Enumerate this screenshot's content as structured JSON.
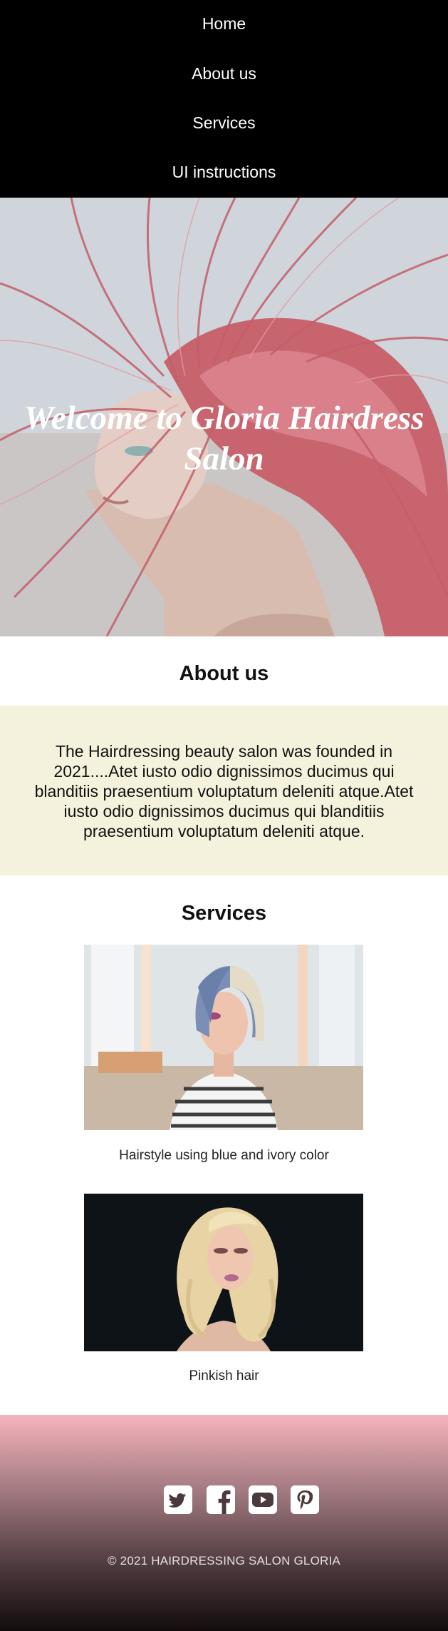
{
  "nav": {
    "items": [
      {
        "label": "Home"
      },
      {
        "label": "About us"
      },
      {
        "label": "Services"
      },
      {
        "label": "UI instructions"
      }
    ]
  },
  "hero": {
    "title": "Welcome to Gloria Hairdress Salon"
  },
  "about": {
    "heading": "About us",
    "text": "The Hairdressing beauty salon was founded in 2021....Atet iusto odio dignissimos ducimus qui blanditiis praesentium voluptatum deleniti atque.Atet iusto odio dignissimos ducimus qui blanditiis praesentium voluptatum deleniti atque."
  },
  "services": {
    "heading": "Services",
    "items": [
      {
        "caption": "Hairstyle using blue and ivory color"
      },
      {
        "caption": "Pinkish hair"
      }
    ]
  },
  "footer": {
    "social": [
      {
        "icon": "twitter-icon"
      },
      {
        "icon": "facebook-icon"
      },
      {
        "icon": "youtube-icon"
      },
      {
        "icon": "pinterest-icon"
      }
    ],
    "copyright": "© 2021 HAIRDRESSING SALON GLORIA"
  },
  "colors": {
    "nav_bg": "#000000",
    "about_bg": "#f4f2dc",
    "footer_top": "#f5b4bd",
    "footer_bottom": "#120b0c"
  }
}
